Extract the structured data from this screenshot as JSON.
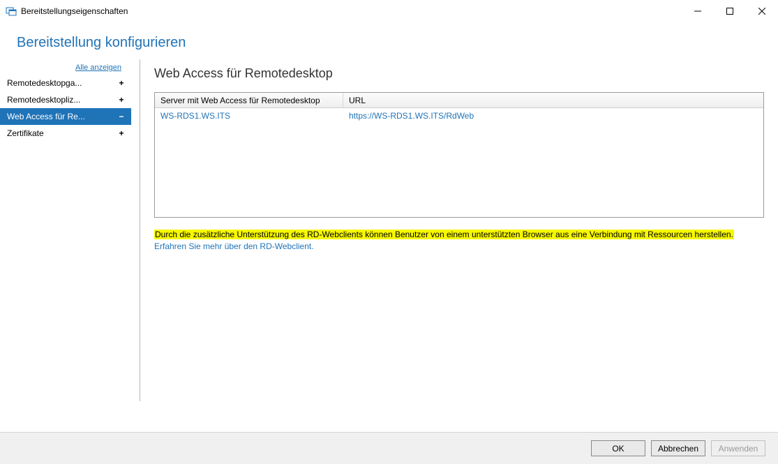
{
  "window": {
    "title": "Bereitstellungseigenschaften"
  },
  "header": {
    "title": "Bereitstellung konfigurieren"
  },
  "sidebar": {
    "all_link": "Alle anzeigen",
    "items": [
      {
        "label": "Remotedesktopga...",
        "toggle": "+"
      },
      {
        "label": "Remotedesktopliz...",
        "toggle": "+"
      },
      {
        "label": "Web Access für Re...",
        "toggle": "−"
      },
      {
        "label": "Zertifikate",
        "toggle": "+"
      }
    ]
  },
  "main": {
    "heading": "Web Access für Remotedesktop",
    "table": {
      "columns": [
        "Server mit Web Access für Remotedesktop",
        "URL"
      ],
      "rows": [
        {
          "server": "WS-RDS1.WS.ITS",
          "url": "https://WS-RDS1.WS.ITS/RdWeb"
        }
      ]
    },
    "info_text": "Durch die zusätzliche Unterstützung des RD-Webclients können Benutzer von einem unterstützten Browser aus eine Verbindung mit Ressourcen herstellen.",
    "info_link": "Erfahren Sie mehr über den RD-Webclient."
  },
  "footer": {
    "ok": "OK",
    "cancel": "Abbrechen",
    "apply": "Anwenden"
  }
}
